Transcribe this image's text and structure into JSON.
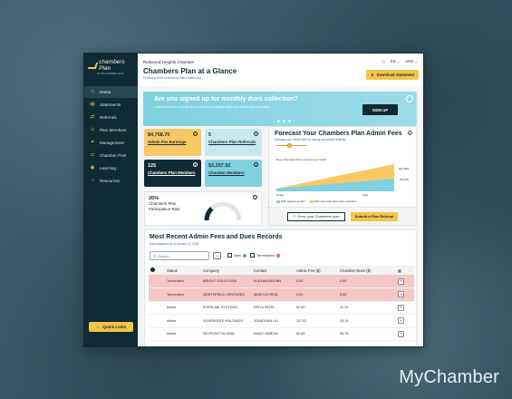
{
  "brand_watermark": "MyChamber",
  "sidebar": {
    "logo_text": "chambers Plan",
    "logo_sub": "BY THE CHAMBER PLAN",
    "items": [
      {
        "label": "Home",
        "icon": "home-icon",
        "glyph": "⌂"
      },
      {
        "label": "Statements",
        "icon": "document-icon",
        "glyph": "▤"
      },
      {
        "label": "Referrals",
        "icon": "referral-icon",
        "glyph": "⇄"
      },
      {
        "label": "Plan Members",
        "icon": "users-icon",
        "glyph": "☺"
      },
      {
        "label": "Management",
        "icon": "management-icon",
        "glyph": "⚭"
      },
      {
        "label": "Chamber Post",
        "icon": "post-icon",
        "glyph": "▭"
      },
      {
        "label": "Learning",
        "icon": "learning-icon",
        "glyph": "◉"
      },
      {
        "label": "Resources",
        "icon": "resources-icon",
        "glyph": "♀"
      }
    ],
    "quick_links": "Quick Links"
  },
  "topbar": {
    "org": "Redwood Heights Chamber",
    "title": "Chambers Plan at a Glance",
    "breadcrumb": "February 2025 Chambers Plan Dashboard",
    "lang": "EN",
    "user": "User",
    "download": "Download Statement"
  },
  "banner": {
    "title": "Are you signed up for monthly dues collection?",
    "text": "Chambers Plan monthly dues collection program helps you retain your members",
    "cta": "SIGN UP"
  },
  "cards": {
    "admin_fee_value": "$4,758.70",
    "admin_fee_label": "Admin Fee Earnings",
    "referrals_value": "5",
    "referrals_label": "Chambers Plan Referrals",
    "members_value": "125",
    "members_label": "Chambers Plan Members",
    "chamber_members_value": "$3,257.92",
    "chamber_members_label": "Chamber Members",
    "participation_value": "26%",
    "participation_label": "Chambers Plan Participation Rate",
    "participation_fraction": 0.26
  },
  "forecast": {
    "title": "Forecast Your Chambers Plan Admin Fees",
    "subtitle": "Increase your admin fees by having successful referrals",
    "caption": "New Chambers Plan members per month",
    "y_high": "$12,995",
    "y_low": "$ 8,245",
    "x_start": "Today",
    "x_end": "Year",
    "legend_organic": "With organic growth",
    "legend_new": "With new Chambers Plan members",
    "color_organic": "#7fd0e0",
    "color_new": "#f8c867",
    "grow_btn": "Grow your Chambers plan",
    "referral_btn": "Submit a Plan Referral"
  },
  "records": {
    "title": "Most Recent Admin Fees and Dues Records",
    "subtitle": "Data displayed as of January 22, 2025",
    "search_placeholder": "Search",
    "new_label": "New",
    "new_count": "3",
    "terminated_label": "Terminated",
    "terminated_count": "2",
    "columns": [
      "Status",
      "Company",
      "Contact",
      "Admin Fee ($)",
      "Chamber Dues ($)"
    ],
    "rows": [
      {
        "status": "Terminated",
        "company": "BRIGHT SOLUTIONS",
        "contact": "ALEXANDRA IBN",
        "fee": "0.00",
        "dues": "0.00",
        "flag": "red"
      },
      {
        "status": "Terminated",
        "company": "NORTHFIELD VENTURES",
        "contact": "MARCUS REID",
        "fee": "0.00",
        "dues": "0.00",
        "flag": "red"
      },
      {
        "status": "Active",
        "company": "EVERLINE SYSTEMS",
        "contact": "PRIYA PATEL",
        "fee": "52.80",
        "dues": "11.20",
        "flag": ""
      },
      {
        "status": "Active",
        "company": "SILVERGATE HOLDINGS",
        "contact": "JONATHAN LIU",
        "fee": "117.92",
        "dues": "25.15",
        "flag": ""
      },
      {
        "status": "Active",
        "company": "SKYPOINT GLOBAL",
        "contact": "EMILY GARCIA",
        "fee": "89.85",
        "dues": "99.76",
        "flag": ""
      }
    ]
  }
}
